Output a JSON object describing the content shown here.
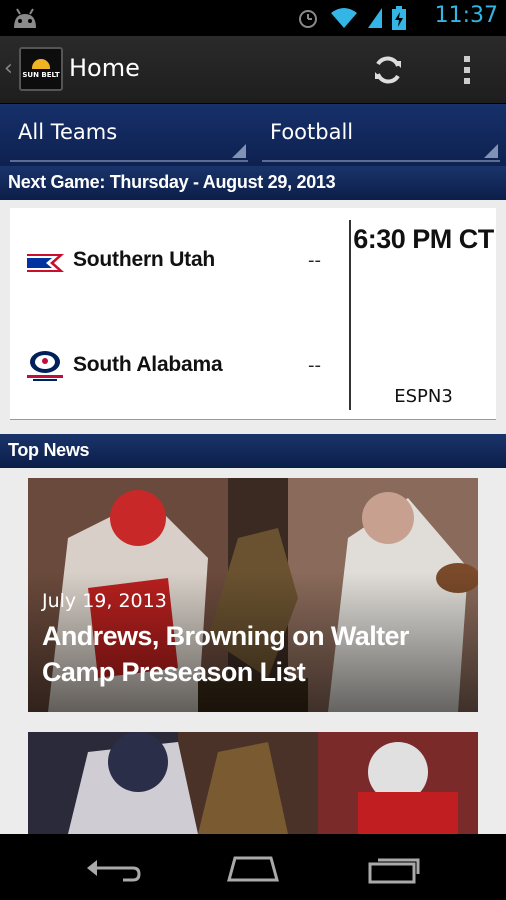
{
  "status_bar": {
    "time": "11:37",
    "icons": [
      "android-icon",
      "alarm-icon",
      "wifi-icon",
      "signal-icon",
      "battery-charging-icon"
    ]
  },
  "action_bar": {
    "title": "Home",
    "logo_text": "SUN BELT",
    "actions": [
      "refresh-icon",
      "overflow-menu-icon"
    ]
  },
  "filters": {
    "team": "All Teams",
    "sport": "Football"
  },
  "next_game": {
    "header": "Next Game: Thursday - August 29, 2013",
    "home_team": {
      "name": "Southern Utah",
      "score": "--"
    },
    "away_team": {
      "name": "South Alabama",
      "score": "--"
    },
    "time": "6:30 PM CT",
    "network": "ESPN3"
  },
  "top_news": {
    "header": "Top News",
    "items": [
      {
        "date": "July 19, 2013",
        "headline": "Andrews, Browning on Walter Camp Preseason List"
      },
      {
        "date": "",
        "headline": ""
      }
    ]
  },
  "colors": {
    "status_accent": "#33b5e5",
    "header_blue": "#0b1e48",
    "action_bar": "#1e1e1e"
  }
}
